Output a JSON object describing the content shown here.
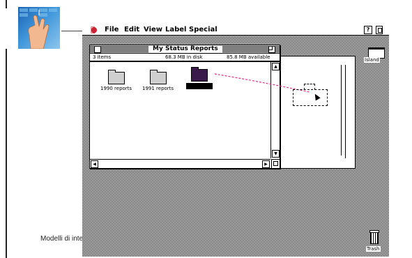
{
  "slide": {
    "footer_text": "Modelli di inter"
  },
  "menubar": {
    "apple_icon": "apple-icon",
    "menus": [
      "File",
      "Edit",
      "View",
      "Label",
      "Special"
    ],
    "help_icon_glyph": "?"
  },
  "desktop": {
    "disk_label": "Island",
    "trash_label": "Trash"
  },
  "window": {
    "title": "My Status Reports",
    "items_count": "3 items",
    "disk_usage": "68.3 MB in disk",
    "available": "85.8 MB available",
    "folders": [
      {
        "label": "1990 reports",
        "selected": false
      },
      {
        "label": "1991 reports",
        "selected": false
      },
      {
        "label": "",
        "selected": true
      }
    ]
  },
  "colors": {
    "drag_line": "#e0308a",
    "selection": "#000000",
    "desktop_pattern": "#9a9a9a"
  }
}
